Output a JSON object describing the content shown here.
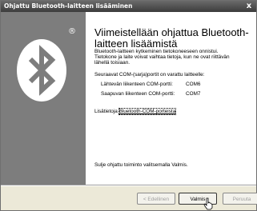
{
  "window": {
    "title": "Ohjattu Bluetooth-laitteen lisääminen",
    "close_glyph": "x"
  },
  "side_panel": {
    "logo_icon": "bluetooth-icon",
    "registered_mark": "®"
  },
  "page": {
    "heading": "Viimeistellään ohjattua Bluetooth-laitteen lisäämistä",
    "info_line1": "Bluetooth-laitteen kytkeminen tietokoneeseen onnistui.",
    "info_line2": "Tietokone ja laite voivat vaihtaa tietoja, kun ne ovat riittävän",
    "info_line3": "lähellä toisiaan.",
    "ports_intro": "Seuraavat COM-(sarja)portit on varattu laitteelle:",
    "ports": [
      {
        "label": "Lähtevän liikenteen COM-portti:",
        "value": "COM6"
      },
      {
        "label": "Saapuvan liikenteen COM-portti:",
        "value": "COM7"
      }
    ],
    "more_info_prefix": "Lisätietoja ",
    "more_info_link": "Bluetooth-COM-porteista",
    "closing_text": "Sulje ohjattu toiminto valitsemalla Valmis."
  },
  "buttons": {
    "back": "< Edellinen",
    "finish": "Valmis",
    "cancel": "Peruuta"
  },
  "colors": {
    "side_panel": "#7d7d7d",
    "titlebar": "#4a4a4a",
    "dialog_bg": "#ece9d8"
  }
}
